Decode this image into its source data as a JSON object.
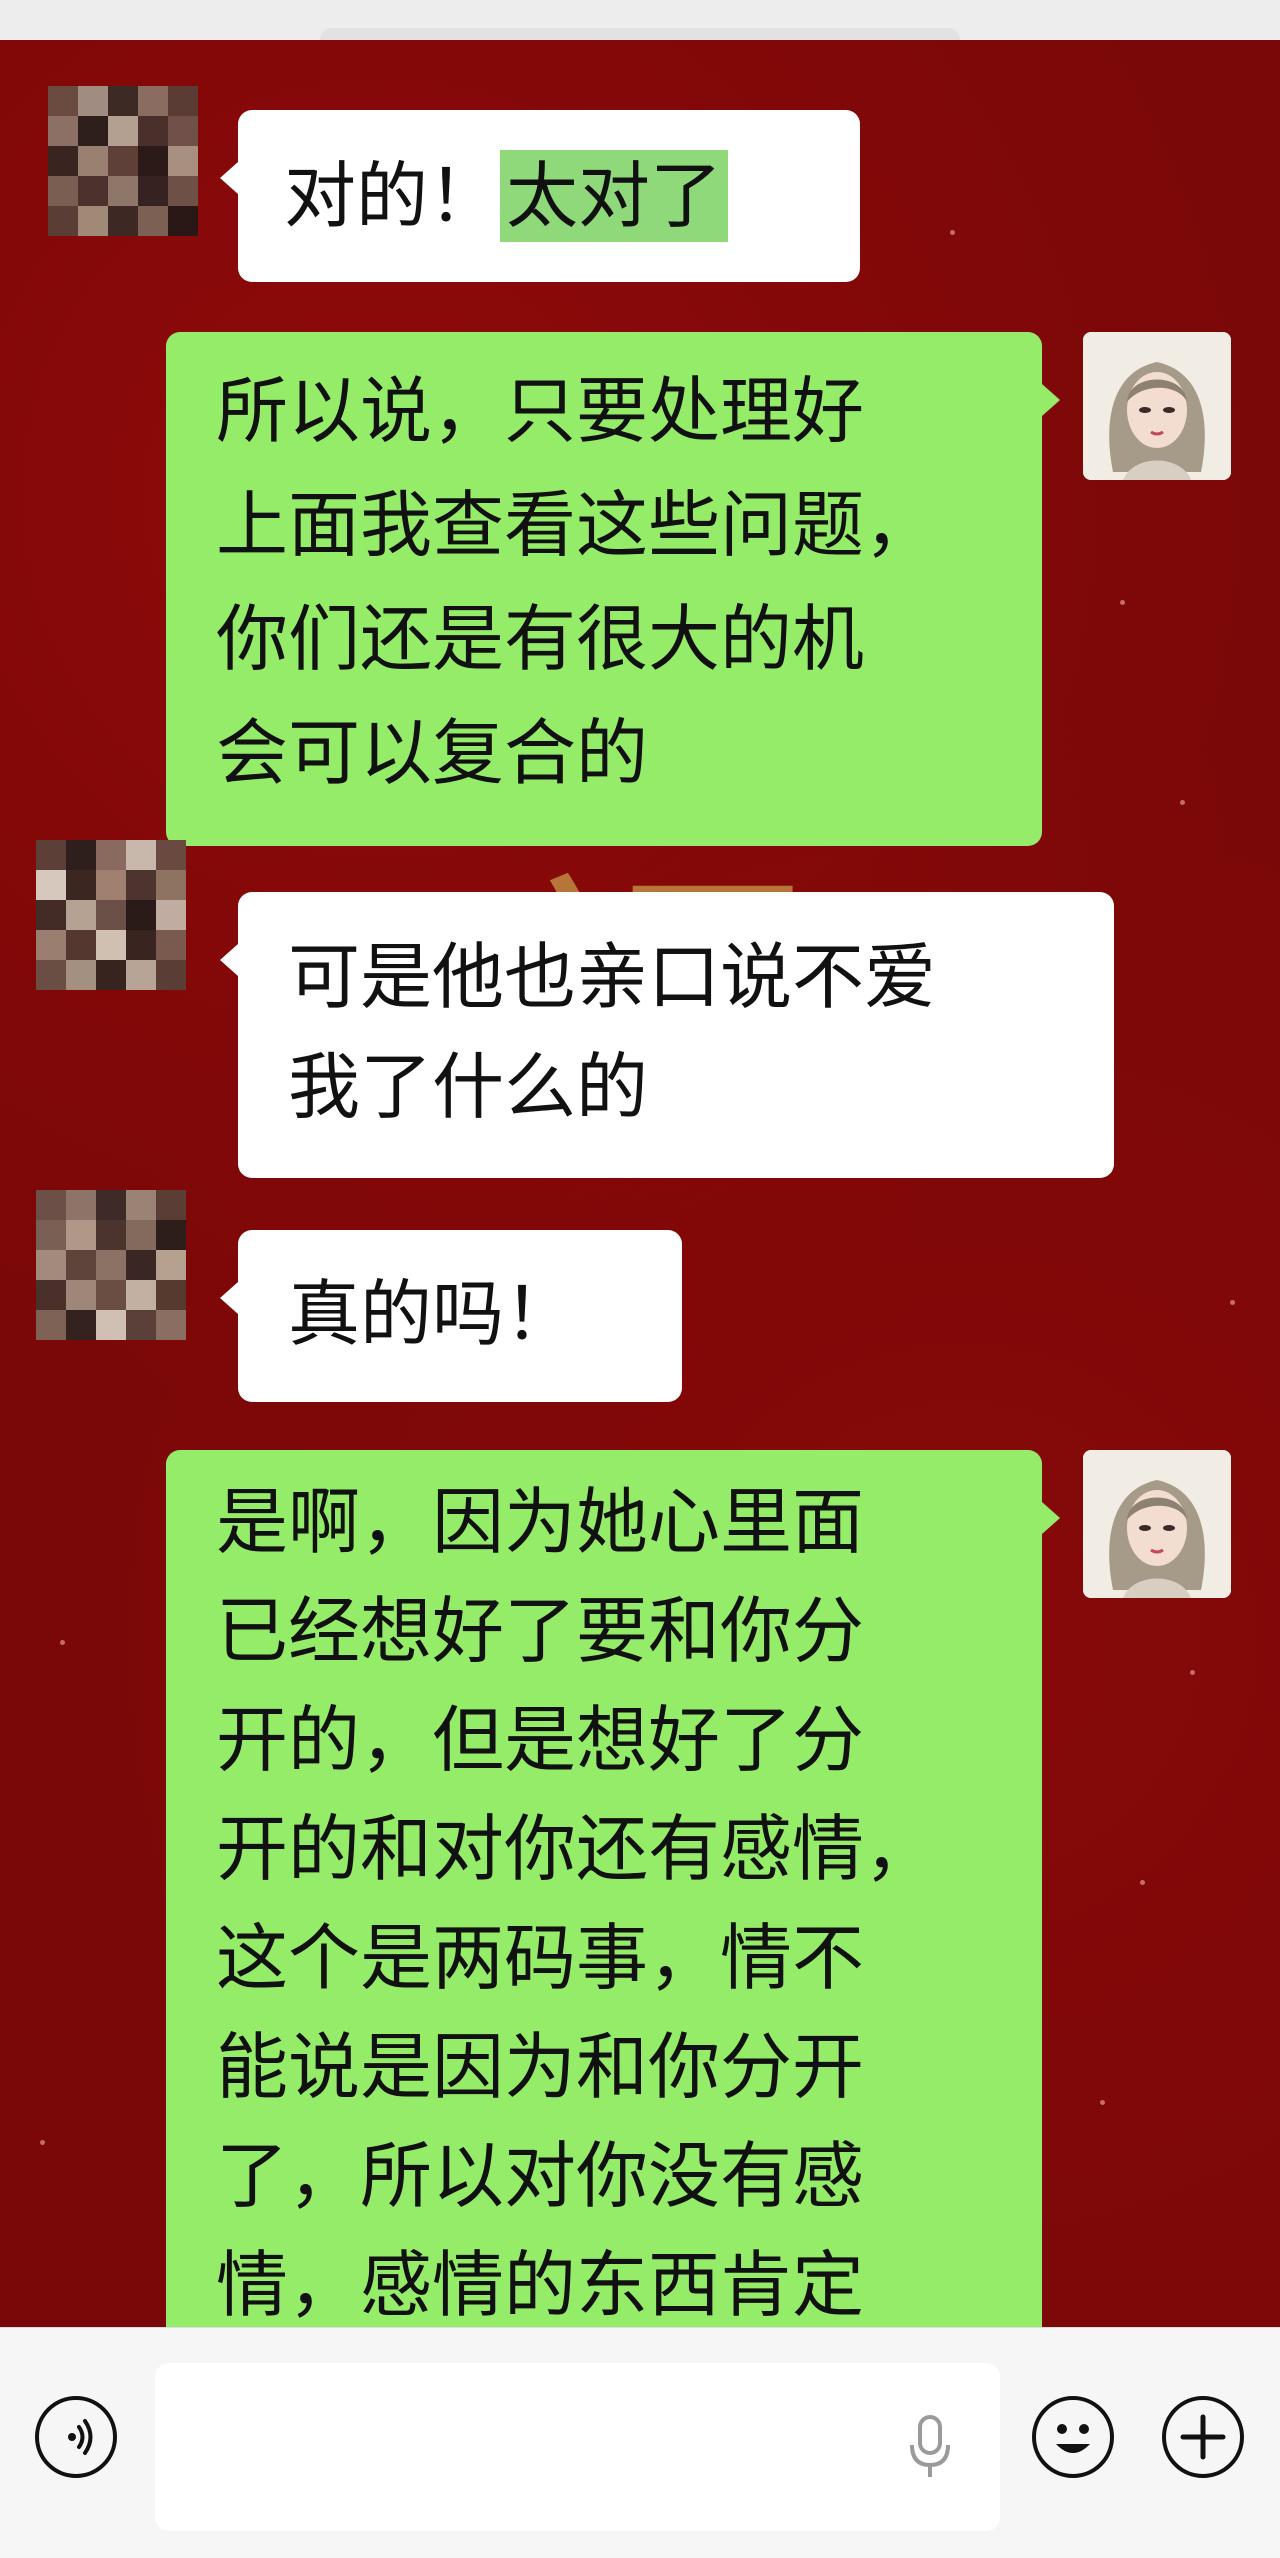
{
  "status_bar": {},
  "messages": [
    {
      "side": "left",
      "text": "对的！",
      "highlight": "太对了"
    },
    {
      "side": "right",
      "text": "所以说，只要处理好\n上面我查看这些问题，\n你们还是有很大的机\n会可以复合的"
    },
    {
      "side": "left",
      "text": "可是他也亲口说不爱\n我了什么的"
    },
    {
      "side": "left",
      "text": "真的吗！"
    },
    {
      "side": "right",
      "text": "是啊，因为她心里面\n已经想好了要和你分\n开的，但是想好了分\n开的和对你还有感情，\n这个是两码事，情不\n能说是因为和你分开\n了，所以对你没有感\n情，感情的东西肯定"
    }
  ],
  "background": {
    "decor_char": "福",
    "bg_color": "#7a0808",
    "gold_color": "#c99a4a"
  },
  "colors": {
    "sent_bubble": "#95ec69",
    "received_bubble": "#ffffff",
    "highlight": "#8fd97a"
  },
  "input_bar": {
    "voice_icon": "voice-mode-icon",
    "mic_icon": "microphone-icon",
    "emoji_icon": "emoji-icon",
    "plus_icon": "plus-icon",
    "text_value": ""
  }
}
